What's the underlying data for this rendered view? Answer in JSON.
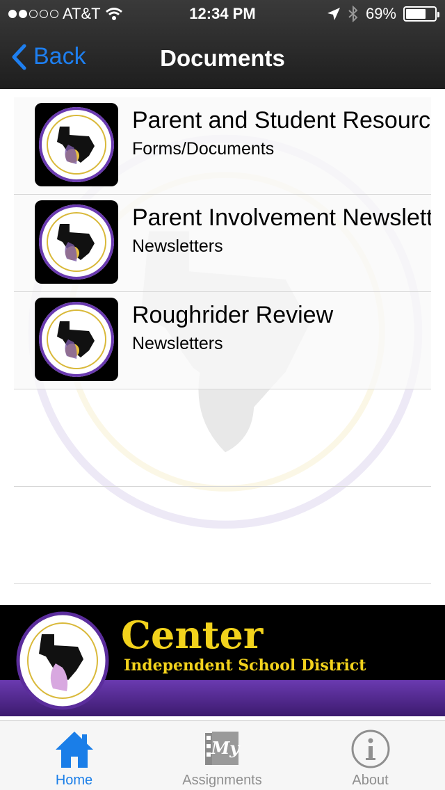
{
  "status_bar": {
    "carrier": "AT&T",
    "time": "12:34 PM",
    "battery": "69%",
    "battery_level": 0.69,
    "signal_bars": 2
  },
  "nav": {
    "back_label": "Back",
    "title": "Documents"
  },
  "documents": [
    {
      "title": "Parent and Student Resources",
      "subtitle": "Forms/Documents"
    },
    {
      "title": "Parent Involvement Newsletter",
      "subtitle": "Newsletters"
    },
    {
      "title": "Roughrider Review",
      "subtitle": "Newsletters"
    }
  ],
  "banner": {
    "name": "Center",
    "subtitle": "Independent School District"
  },
  "tabs": [
    {
      "label": "Home",
      "icon": "home-icon",
      "active": true
    },
    {
      "label": "Assignments",
      "icon": "my-assignments-icon",
      "active": false
    },
    {
      "label": "About",
      "icon": "info-icon",
      "active": false
    }
  ],
  "colors": {
    "accent": "#1a7ee8",
    "brand_gold": "#f2d21c",
    "brand_purple": "#5b2d9c"
  }
}
